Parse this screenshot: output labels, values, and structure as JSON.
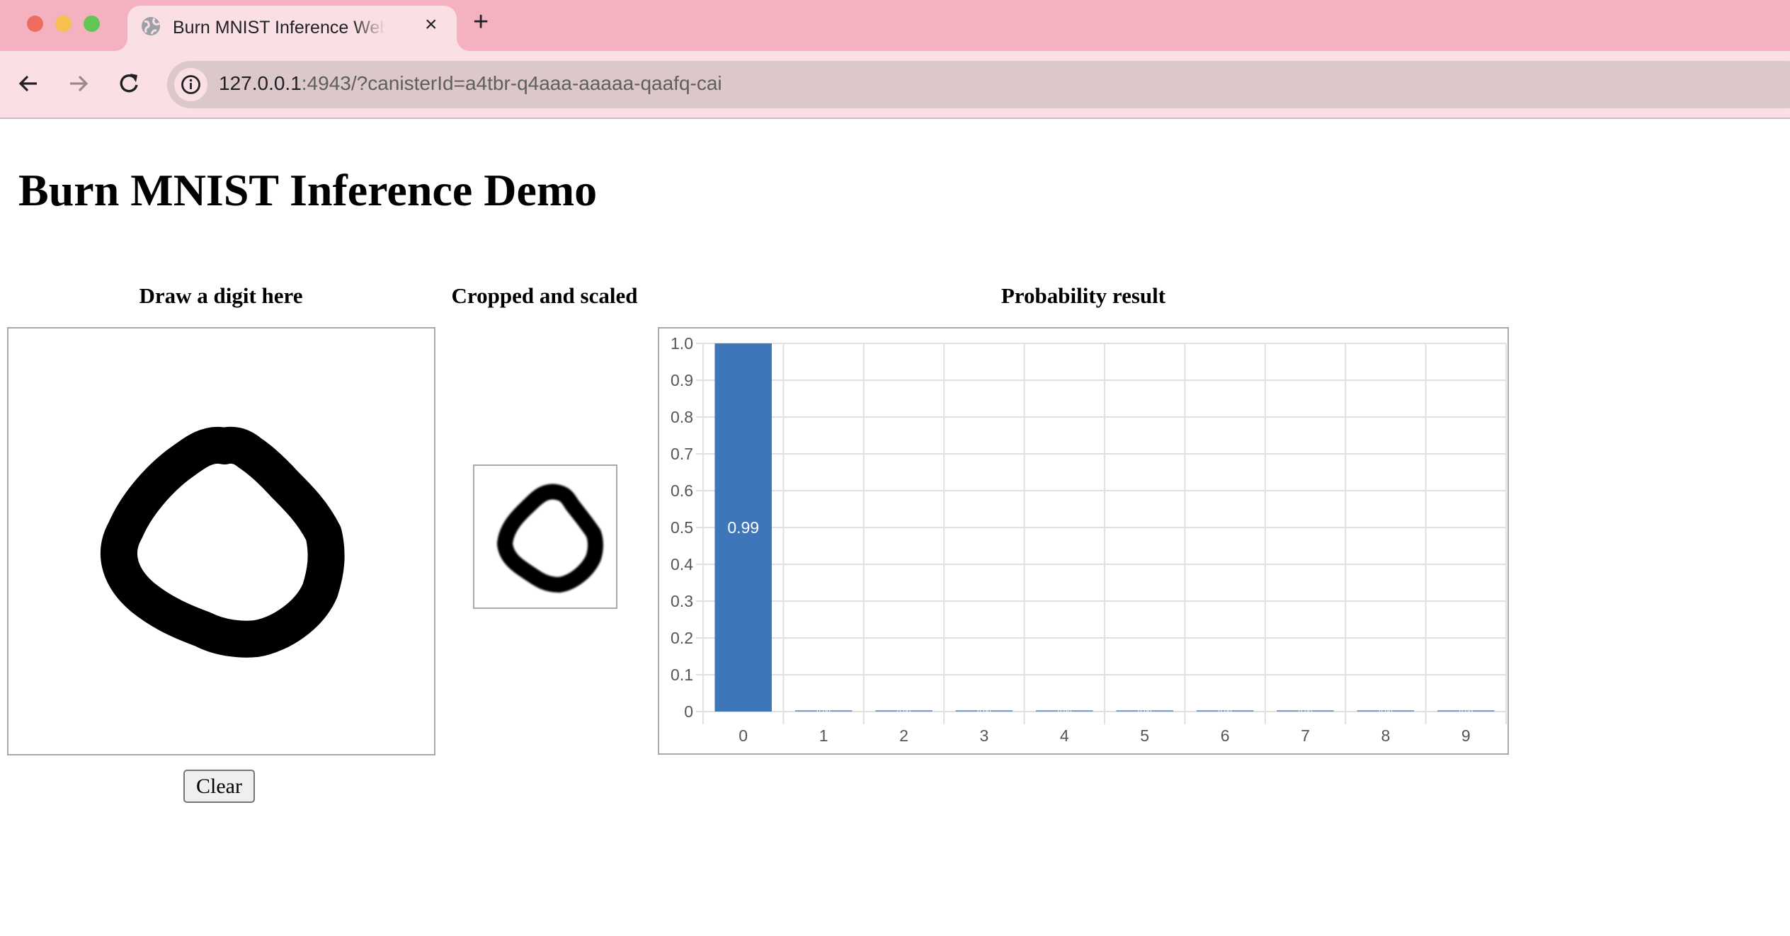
{
  "browser": {
    "tab_title": "Burn MNIST Inference Web Demo",
    "url_host": "127.0.0.1",
    "url_rest": ":4943/?canisterId=a4tbr-q4aaa-aaaaa-qaafq-cai",
    "icons": {
      "close": "×",
      "new_tab": "+"
    },
    "colors": {
      "tabstrip": "#f4b1c0",
      "toolbar": "#fae0e5",
      "urlbar": "#dcc7ca"
    }
  },
  "page": {
    "title": "Burn MNIST Inference Demo",
    "draw_heading": "Draw a digit here",
    "cropped_heading": "Cropped and scaled",
    "result_heading": "Probability result",
    "clear_label": "Clear",
    "drawn_digit": "0"
  },
  "chart_data": {
    "type": "bar",
    "title": "Probability result",
    "categories": [
      "0",
      "1",
      "2",
      "3",
      "4",
      "5",
      "6",
      "7",
      "8",
      "9"
    ],
    "values": [
      0.99,
      0.0,
      0.0,
      0.0,
      0.0,
      0.0,
      0.0,
      0.0,
      0.0,
      0.0
    ],
    "data_labels": [
      "0.99",
      "0.00",
      "0.00",
      "0.00",
      "0.00",
      "0.00",
      "0.00",
      "0.00",
      "0.00",
      "0.00"
    ],
    "yticks": [
      "0",
      "0.1",
      "0.2",
      "0.3",
      "0.4",
      "0.5",
      "0.6",
      "0.7",
      "0.8",
      "0.9",
      "1.0"
    ],
    "xlabel": "",
    "ylabel": "",
    "ylim": [
      0,
      1
    ],
    "grid": true,
    "legend": "none",
    "bar_color": "#3e76b9"
  }
}
